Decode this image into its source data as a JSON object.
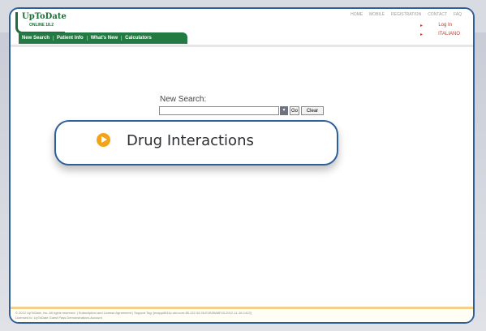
{
  "header": {
    "logo_main": "UpToDate",
    "logo_sub": "ONLINE 18.2",
    "tabs": [
      "New Search",
      "Patient Info",
      "What's New",
      "Calculators"
    ],
    "top_links": [
      "HOME",
      "MOBILE",
      "REGISTRATION",
      "CONTACT",
      "FAQ"
    ],
    "login": "Log In",
    "language": "ITALIANO"
  },
  "search": {
    "label": "New Search:",
    "value": "",
    "go": "Go",
    "clear": "Clear"
  },
  "callout": {
    "label": "Drug Interactions"
  },
  "footer": {
    "line1": "© 2012 UpToDate, Inc. All rights reserved.   |   Subscription and License Agreement   |   Support Tag: [ecapp0611p.utd.com-85.132.34.26-E1B39A8F43-2012-11-16-1413]",
    "line2": "Licensed to: UpToDate Guest Pass Demonstrations Account"
  },
  "colors": {
    "accent_green": "#237a43",
    "frame_blue": "#2f5f9a",
    "icon_orange": "#f2a31a"
  }
}
